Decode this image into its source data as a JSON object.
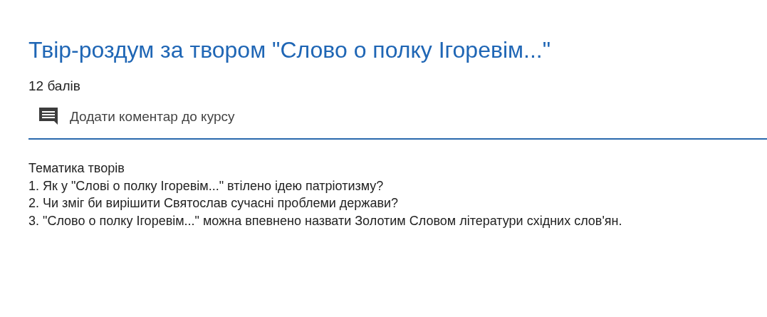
{
  "assignment": {
    "title": "Твір-роздум за твором \"Слово о полку Ігоревім...\"",
    "points": "12 балів",
    "comment_link": "Додати коментар до курсу",
    "description": [
      "Тематика творів",
      "1. Як у \"Слові о полку Ігоревім...\" втілено ідею патріотизму?",
      "2. Чи зміг би вирішити Святослав сучасні проблеми держави?",
      "3. \"Слово о полку Ігоревім...\" можна впевнено назвати Золотим Словом літератури східних слов'ян."
    ]
  }
}
